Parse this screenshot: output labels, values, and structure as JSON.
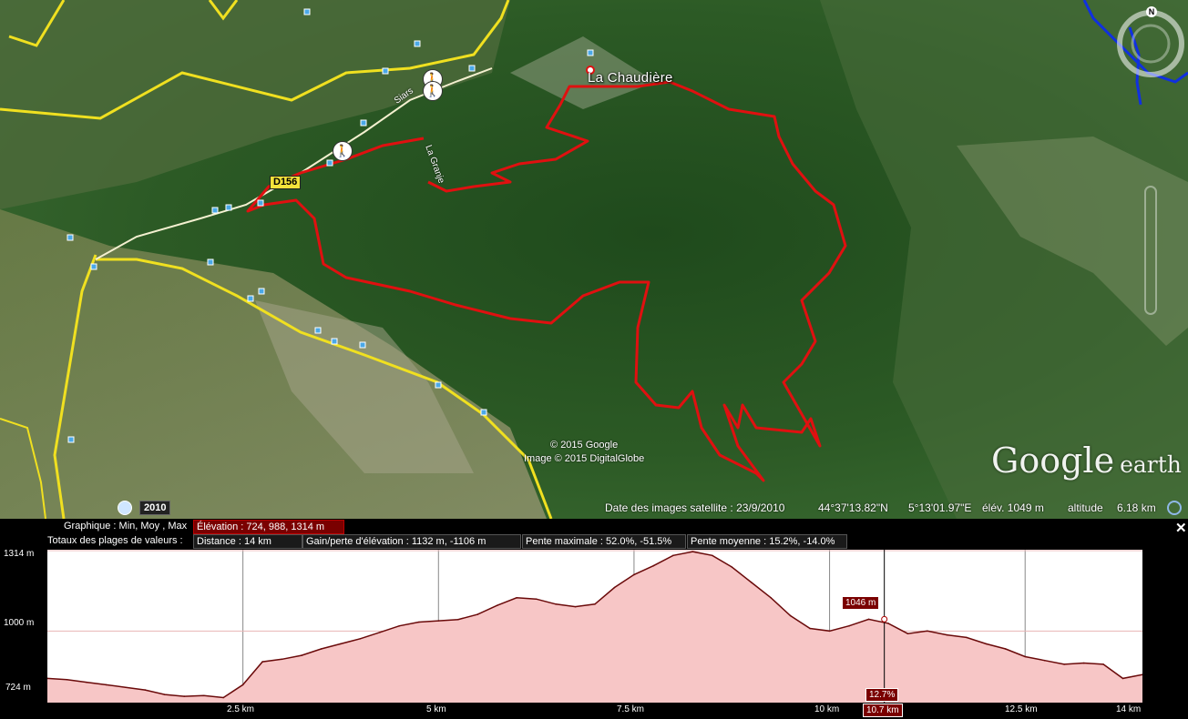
{
  "map": {
    "place_name": "La Chaudière",
    "road_shield": "D156",
    "road_names": [
      "Siars",
      "La Granje"
    ],
    "copyright_lines": [
      "© 2015 Google",
      "Image © 2015 DigitalGlobe"
    ],
    "logo_text": "Google",
    "logo_text_suffix": "earth",
    "compass_label": "N",
    "year_button": "2010",
    "status": {
      "imagery_date": "Date des images satellite : 23/9/2010",
      "latitude": "44°37'13.82\"N",
      "longitude": "5°13'01.97\"E",
      "elevation": "élév. 1049 m",
      "altitude_label": "altitude",
      "altitude_value": "6.18 km"
    },
    "colors": {
      "track": "#e01010",
      "road": "#f0e020",
      "river": "#1030e0"
    },
    "icons": [
      "hiker-icon",
      "clock-icon",
      "compass-icon",
      "close-icon"
    ]
  },
  "profile": {
    "graph_label": "Graphique : Min, Moy , Max",
    "elevation_stats": "Élévation : 724, 988, 1314 m",
    "totals_label": "Totaux des plages de valeurs :",
    "distance": "Distance : 14 km",
    "gain_loss": "Gain/perte d'élévation : 1132 m, -1106 m",
    "max_slope": "Pente maximale : 52.0%, -51.5%",
    "avg_slope": "Pente moyenne : 15.2%, -14.0%",
    "y_ticks": [
      "1314 m",
      "1000 m",
      "724 m"
    ],
    "x_ticks": [
      "2.5 km",
      "5 km",
      "7.5 km",
      "10 km",
      "12.5 km",
      "14 km"
    ],
    "cursor_elevation": "1046 m",
    "cursor_slope": "12.7%",
    "cursor_distance": "10.7 km"
  },
  "chart_data": {
    "type": "area",
    "xlabel": "",
    "ylabel": "",
    "xlim": [
      0,
      14
    ],
    "ylim": [
      724,
      1314
    ],
    "x": [
      0,
      0.25,
      0.5,
      0.75,
      1.0,
      1.25,
      1.5,
      1.75,
      2.0,
      2.25,
      2.5,
      2.75,
      3.0,
      3.25,
      3.5,
      3.75,
      4.0,
      4.25,
      4.5,
      4.75,
      5.0,
      5.25,
      5.5,
      5.75,
      6.0,
      6.25,
      6.5,
      6.75,
      7.0,
      7.25,
      7.5,
      7.75,
      8.0,
      8.25,
      8.5,
      8.75,
      9.0,
      9.25,
      9.5,
      9.75,
      10.0,
      10.25,
      10.5,
      10.75,
      11.0,
      11.25,
      11.5,
      11.75,
      12.0,
      12.25,
      12.5,
      12.75,
      13.0,
      13.25,
      13.5,
      13.75,
      14.0
    ],
    "y": [
      815,
      810,
      800,
      790,
      780,
      770,
      752,
      745,
      748,
      740,
      790,
      880,
      890,
      905,
      930,
      950,
      970,
      995,
      1020,
      1035,
      1040,
      1045,
      1065,
      1100,
      1130,
      1125,
      1105,
      1095,
      1105,
      1170,
      1220,
      1255,
      1295,
      1310,
      1295,
      1250,
      1190,
      1130,
      1060,
      1010,
      1000,
      1020,
      1046,
      1030,
      990,
      1000,
      985,
      975,
      950,
      930,
      900,
      885,
      870,
      875,
      870,
      815,
      830
    ]
  }
}
